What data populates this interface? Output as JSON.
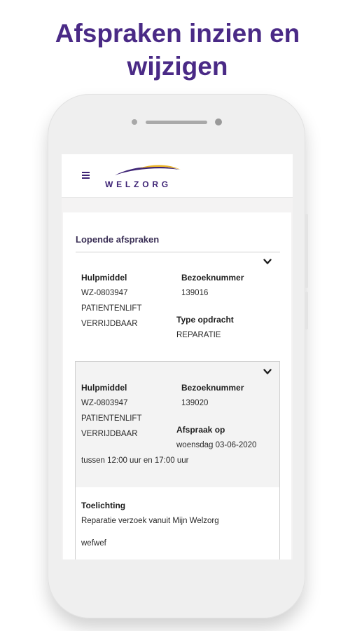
{
  "headline": {
    "line1": "Afspraken inzien en",
    "line2": "wijzigen"
  },
  "app": {
    "brand": "WELZORG",
    "colors": {
      "brand_purple": "#3d2375",
      "headline_purple": "#4a2a86",
      "logo_gold": "#e8b22a"
    },
    "menu_icon": "hamburger-menu-icon"
  },
  "section": {
    "title": "Lopende afspraken"
  },
  "appointments": [
    {
      "hulpmiddel_label": "Hulpmiddel",
      "hulpmiddel_code": "WZ-0803947",
      "hulpmiddel_line2": "PATIENTENLIFT",
      "hulpmiddel_line3": "VERRIJDBAAR",
      "bezoek_label": "Bezoeknummer",
      "bezoek_value": "139016",
      "type_label": "Type opdracht",
      "type_value": "REPARATIE",
      "toggle_icon": "chevron-down-icon"
    },
    {
      "hulpmiddel_label": "Hulpmiddel",
      "hulpmiddel_code": "WZ-0803947",
      "hulpmiddel_line2": "PATIENTENLIFT",
      "hulpmiddel_line3": "VERRIJDBAAR",
      "bezoek_label": "Bezoeknummer",
      "bezoek_value": "139020",
      "afspraak_label": "Afspraak op",
      "afspraak_value": "woensdag 03-06-2020",
      "time_range": "tussen 12:00 uur en 17:00 uur",
      "toelichting_label": "Toelichting",
      "toelichting_value": "Reparatie verzoek vanuit Mijn Welzorg",
      "note": "wefwef",
      "toggle_icon": "chevron-down-icon"
    }
  ]
}
